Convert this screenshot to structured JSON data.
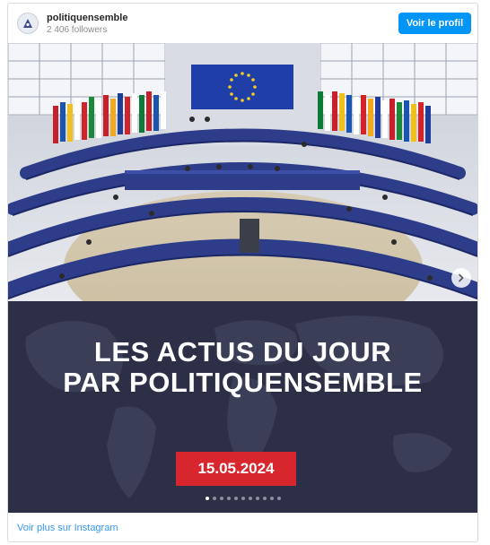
{
  "header": {
    "username": "politiquensemble",
    "followers": "2 406 followers",
    "profile_button": "Voir le profil"
  },
  "post": {
    "headline_line1": "LES ACTUS DU JOUR",
    "headline_line2": "PAR POLITIQUENSEMBLE",
    "date": "15.05.2024",
    "carousel_total": 11,
    "carousel_active": 1
  },
  "footer": {
    "more_link": "Voir plus sur Instagram"
  },
  "colors": {
    "accent": "#0095f6",
    "banner_bg": "#2c2f45",
    "date_badge": "#d8262e",
    "link": "#3897f0"
  },
  "icons": [
    "party-logo-icon",
    "chevron-right-icon"
  ]
}
